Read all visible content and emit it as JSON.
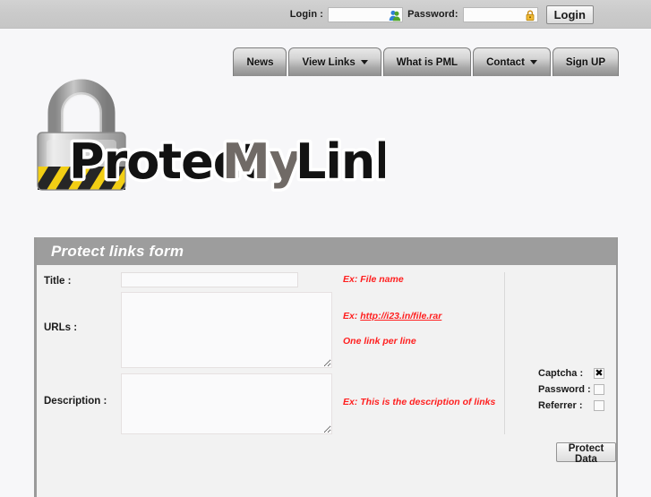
{
  "topbar": {
    "login_label": "Login :",
    "login_value": "",
    "login_placeholder": "",
    "login_icon": "users-icon",
    "password_label": "Password:",
    "password_value": "",
    "password_placeholder": "",
    "password_icon": "padlock-icon",
    "login_button": "Login"
  },
  "nav": {
    "items": [
      {
        "label": "News",
        "has_caret": false
      },
      {
        "label": "View Links",
        "has_caret": true
      },
      {
        "label": "What is PML",
        "has_caret": false
      },
      {
        "label": "Contact",
        "has_caret": true
      },
      {
        "label": "Sign UP",
        "has_caret": false
      }
    ]
  },
  "logo": {
    "text_1": "Protect",
    "text_2": "My",
    "text_3": "Links",
    "alt": "padlock-logo"
  },
  "form": {
    "title": "Protect links form",
    "fields": {
      "title_label": "Title :",
      "title_value": "",
      "title_placeholder": "",
      "urls_label": "URLs :",
      "urls_value": "",
      "urls_placeholder": "",
      "description_label": "Description :",
      "description_value": "",
      "description_placeholder": ""
    },
    "hints": {
      "title": "Ex: File name",
      "urls_prefix": "Ex: ",
      "urls_link": "http://i23.in/file.rar",
      "urls_note": "One link per line",
      "description": "Ex: This is the description of links"
    },
    "options": [
      {
        "label": "Captcha :",
        "checked": true
      },
      {
        "label": "Password :",
        "checked": false
      },
      {
        "label": "Referrer :",
        "checked": false
      }
    ],
    "submit_label": "Protect Data"
  },
  "colors": {
    "topbar": "#cacaca",
    "panel_header": "#9d9d9d",
    "hint_red": "#ff2020",
    "link_blue": "#2222dd",
    "page_bg": "#f7f7f9"
  }
}
